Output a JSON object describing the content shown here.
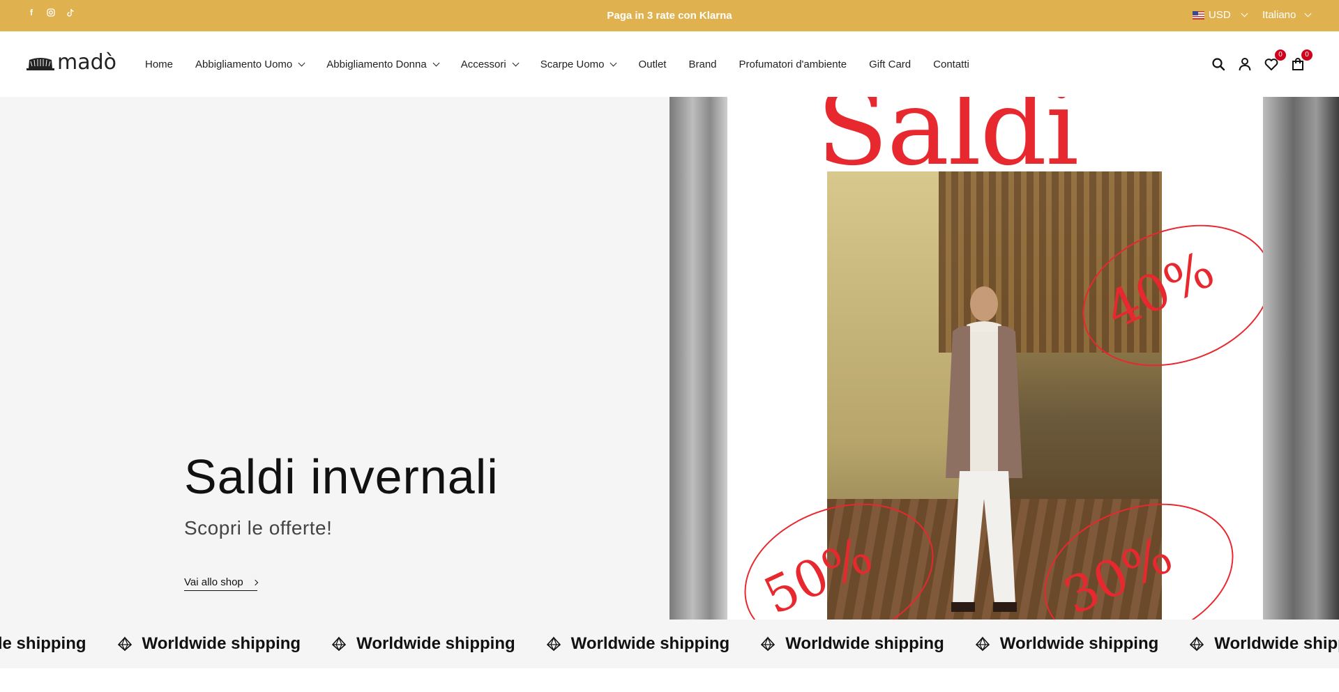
{
  "topbar": {
    "promo": "Paga in 3 rate con Klarna",
    "currency": "USD",
    "language": "Italiano",
    "socials": [
      {
        "name": "facebook-icon",
        "glyph": "f"
      },
      {
        "name": "instagram-icon",
        "glyph": "◎"
      },
      {
        "name": "tiktok-icon",
        "glyph": "♪"
      }
    ]
  },
  "header": {
    "logo_text": "madò",
    "nav": [
      {
        "label": "Home",
        "has_dropdown": false
      },
      {
        "label": "Abbigliamento Uomo",
        "has_dropdown": true
      },
      {
        "label": "Abbigliamento Donna",
        "has_dropdown": true
      },
      {
        "label": "Accessori",
        "has_dropdown": true
      },
      {
        "label": "Scarpe Uomo",
        "has_dropdown": true
      },
      {
        "label": "Outlet",
        "has_dropdown": false
      },
      {
        "label": "Brand",
        "has_dropdown": false
      },
      {
        "label": "Profumatori d'ambiente",
        "has_dropdown": false
      },
      {
        "label": "Gift Card",
        "has_dropdown": false
      },
      {
        "label": "Contatti",
        "has_dropdown": false
      }
    ],
    "wishlist_count": "0",
    "cart_count": "0"
  },
  "hero": {
    "title": "Saldi invernali",
    "subtitle": "Scopri le offerte!",
    "cta": "Vai allo shop",
    "poster": {
      "headline": "Saldi",
      "discounts": [
        "40%",
        "50%",
        "30%"
      ]
    }
  },
  "marquee": {
    "text": "Worldwide shipping",
    "repeats": 7
  },
  "colors": {
    "announcement_bg": "#e0b24f",
    "sale_red": "#e8282f",
    "badge_red": "#d0021b"
  }
}
